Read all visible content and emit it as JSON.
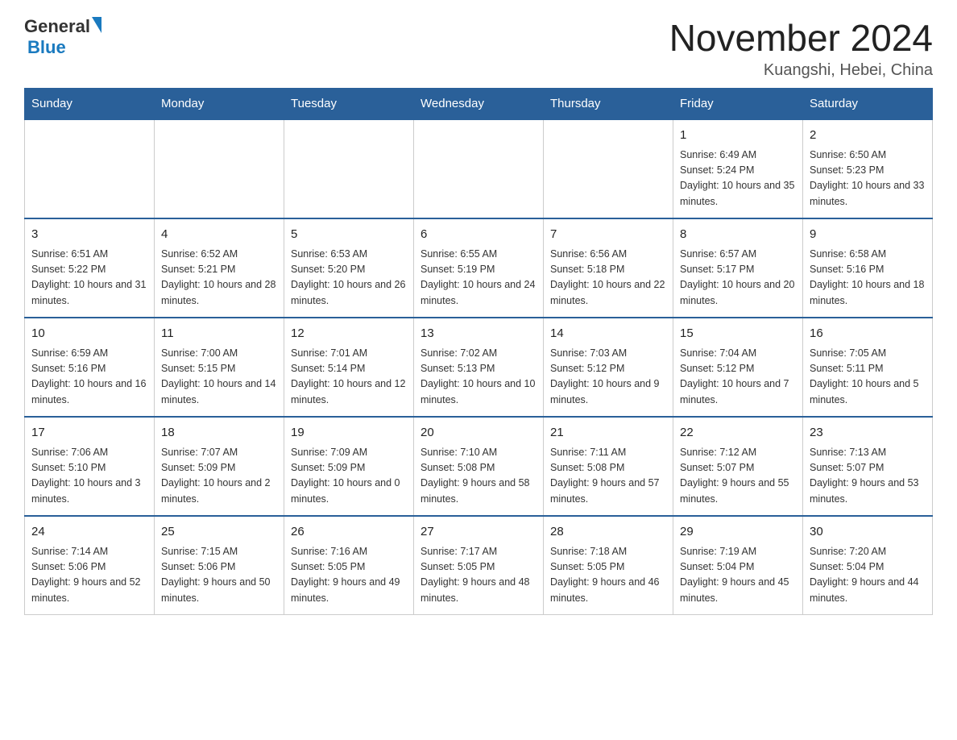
{
  "logo": {
    "general": "General",
    "triangle": "▲",
    "blue": "Blue"
  },
  "title": {
    "month": "November 2024",
    "location": "Kuangshi, Hebei, China"
  },
  "days_of_week": [
    "Sunday",
    "Monday",
    "Tuesday",
    "Wednesday",
    "Thursday",
    "Friday",
    "Saturday"
  ],
  "weeks": [
    [
      {
        "day": "",
        "info": ""
      },
      {
        "day": "",
        "info": ""
      },
      {
        "day": "",
        "info": ""
      },
      {
        "day": "",
        "info": ""
      },
      {
        "day": "",
        "info": ""
      },
      {
        "day": "1",
        "info": "Sunrise: 6:49 AM\nSunset: 5:24 PM\nDaylight: 10 hours and 35 minutes."
      },
      {
        "day": "2",
        "info": "Sunrise: 6:50 AM\nSunset: 5:23 PM\nDaylight: 10 hours and 33 minutes."
      }
    ],
    [
      {
        "day": "3",
        "info": "Sunrise: 6:51 AM\nSunset: 5:22 PM\nDaylight: 10 hours and 31 minutes."
      },
      {
        "day": "4",
        "info": "Sunrise: 6:52 AM\nSunset: 5:21 PM\nDaylight: 10 hours and 28 minutes."
      },
      {
        "day": "5",
        "info": "Sunrise: 6:53 AM\nSunset: 5:20 PM\nDaylight: 10 hours and 26 minutes."
      },
      {
        "day": "6",
        "info": "Sunrise: 6:55 AM\nSunset: 5:19 PM\nDaylight: 10 hours and 24 minutes."
      },
      {
        "day": "7",
        "info": "Sunrise: 6:56 AM\nSunset: 5:18 PM\nDaylight: 10 hours and 22 minutes."
      },
      {
        "day": "8",
        "info": "Sunrise: 6:57 AM\nSunset: 5:17 PM\nDaylight: 10 hours and 20 minutes."
      },
      {
        "day": "9",
        "info": "Sunrise: 6:58 AM\nSunset: 5:16 PM\nDaylight: 10 hours and 18 minutes."
      }
    ],
    [
      {
        "day": "10",
        "info": "Sunrise: 6:59 AM\nSunset: 5:16 PM\nDaylight: 10 hours and 16 minutes."
      },
      {
        "day": "11",
        "info": "Sunrise: 7:00 AM\nSunset: 5:15 PM\nDaylight: 10 hours and 14 minutes."
      },
      {
        "day": "12",
        "info": "Sunrise: 7:01 AM\nSunset: 5:14 PM\nDaylight: 10 hours and 12 minutes."
      },
      {
        "day": "13",
        "info": "Sunrise: 7:02 AM\nSunset: 5:13 PM\nDaylight: 10 hours and 10 minutes."
      },
      {
        "day": "14",
        "info": "Sunrise: 7:03 AM\nSunset: 5:12 PM\nDaylight: 10 hours and 9 minutes."
      },
      {
        "day": "15",
        "info": "Sunrise: 7:04 AM\nSunset: 5:12 PM\nDaylight: 10 hours and 7 minutes."
      },
      {
        "day": "16",
        "info": "Sunrise: 7:05 AM\nSunset: 5:11 PM\nDaylight: 10 hours and 5 minutes."
      }
    ],
    [
      {
        "day": "17",
        "info": "Sunrise: 7:06 AM\nSunset: 5:10 PM\nDaylight: 10 hours and 3 minutes."
      },
      {
        "day": "18",
        "info": "Sunrise: 7:07 AM\nSunset: 5:09 PM\nDaylight: 10 hours and 2 minutes."
      },
      {
        "day": "19",
        "info": "Sunrise: 7:09 AM\nSunset: 5:09 PM\nDaylight: 10 hours and 0 minutes."
      },
      {
        "day": "20",
        "info": "Sunrise: 7:10 AM\nSunset: 5:08 PM\nDaylight: 9 hours and 58 minutes."
      },
      {
        "day": "21",
        "info": "Sunrise: 7:11 AM\nSunset: 5:08 PM\nDaylight: 9 hours and 57 minutes."
      },
      {
        "day": "22",
        "info": "Sunrise: 7:12 AM\nSunset: 5:07 PM\nDaylight: 9 hours and 55 minutes."
      },
      {
        "day": "23",
        "info": "Sunrise: 7:13 AM\nSunset: 5:07 PM\nDaylight: 9 hours and 53 minutes."
      }
    ],
    [
      {
        "day": "24",
        "info": "Sunrise: 7:14 AM\nSunset: 5:06 PM\nDaylight: 9 hours and 52 minutes."
      },
      {
        "day": "25",
        "info": "Sunrise: 7:15 AM\nSunset: 5:06 PM\nDaylight: 9 hours and 50 minutes."
      },
      {
        "day": "26",
        "info": "Sunrise: 7:16 AM\nSunset: 5:05 PM\nDaylight: 9 hours and 49 minutes."
      },
      {
        "day": "27",
        "info": "Sunrise: 7:17 AM\nSunset: 5:05 PM\nDaylight: 9 hours and 48 minutes."
      },
      {
        "day": "28",
        "info": "Sunrise: 7:18 AM\nSunset: 5:05 PM\nDaylight: 9 hours and 46 minutes."
      },
      {
        "day": "29",
        "info": "Sunrise: 7:19 AM\nSunset: 5:04 PM\nDaylight: 9 hours and 45 minutes."
      },
      {
        "day": "30",
        "info": "Sunrise: 7:20 AM\nSunset: 5:04 PM\nDaylight: 9 hours and 44 minutes."
      }
    ]
  ]
}
